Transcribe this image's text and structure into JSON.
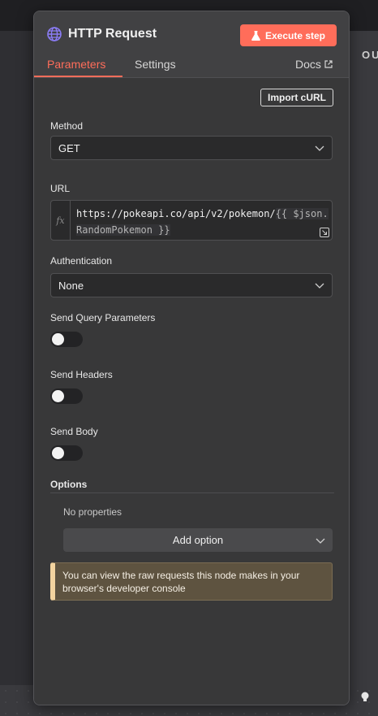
{
  "background": {
    "right_panel_label": "OU"
  },
  "node": {
    "title": "HTTP Request",
    "execute_label": "Execute step",
    "tabs": [
      "Parameters",
      "Settings"
    ],
    "docs_label": "Docs"
  },
  "params": {
    "import_label": "Import cURL",
    "method": {
      "label": "Method",
      "value": "GET"
    },
    "url": {
      "label": "URL",
      "fx": "fx",
      "static_part": "https://pokeapi.co/api/v2/pokemon/",
      "expression_part": "{{ $json.RandomPokemon }}"
    },
    "authentication": {
      "label": "Authentication",
      "value": "None"
    },
    "send_query": {
      "label": "Send Query Parameters",
      "enabled": false
    },
    "send_headers": {
      "label": "Send Headers",
      "enabled": false
    },
    "send_body": {
      "label": "Send Body",
      "enabled": false
    },
    "options": {
      "label": "Options",
      "empty_text": "No properties",
      "add_label": "Add option"
    },
    "notice": "You can view the raw requests this node makes in your browser's developer console"
  },
  "colors": {
    "accent": "#ff6d5a",
    "notice_bg": "#5e5340",
    "notice_border": "#f4d49f"
  }
}
